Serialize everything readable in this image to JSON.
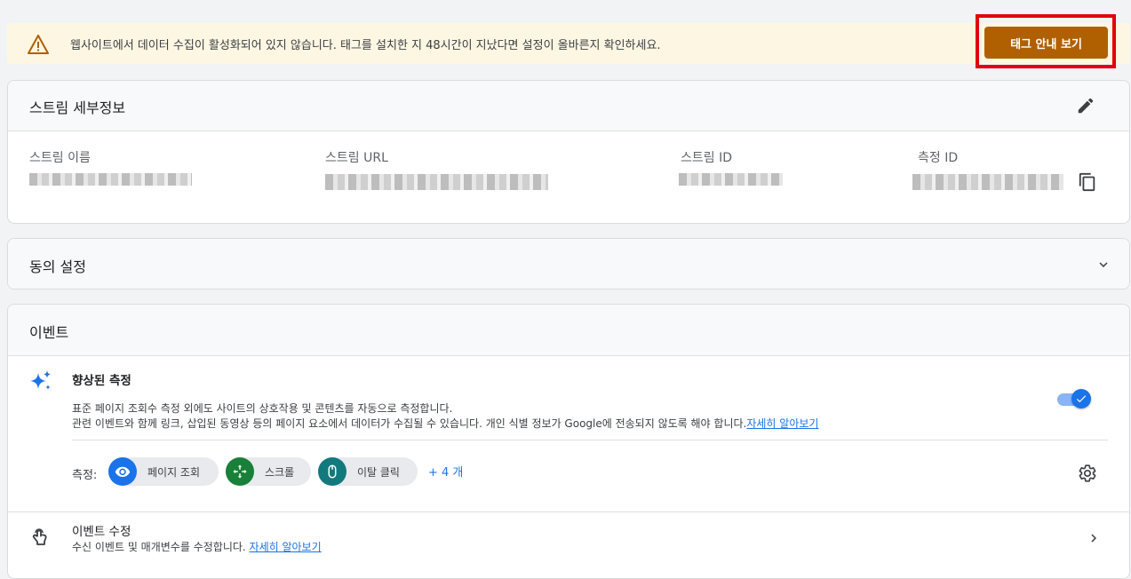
{
  "banner": {
    "message": "웹사이트에서 데이터 수집이 활성화되어 있지 않습니다. 태그를 설치한 지 48시간이 지났다면 설정이 올바른지 확인하세요.",
    "button_label": "태그 안내 보기",
    "icon": "warning-icon"
  },
  "stream_details": {
    "title": "스트림 세부정보",
    "fields": [
      {
        "label": "스트림 이름"
      },
      {
        "label": "스트림 URL"
      },
      {
        "label": "스트림 ID"
      },
      {
        "label": "측정 ID"
      }
    ]
  },
  "consent": {
    "title": "동의 설정"
  },
  "events": {
    "title": "이벤트",
    "enhanced": {
      "title": "향상된 측정",
      "desc_line1": "표준 페이지 조회수 측정 외에도 사이트의 상호작용 및 콘텐츠를 자동으로 측정합니다.",
      "desc_line2": "관련 이벤트와 함께 링크, 삽입된 동영상 등의 페이지 요소에서 데이터가 수집될 수 있습니다. 개인 식별 정보가 Google에 전송되지 않도록 해야 합니다.",
      "learn_more": "자세히 알아보기",
      "toggle_on": true,
      "measure_label": "측정:",
      "chips": [
        {
          "label": "페이지 조회",
          "icon": "eye-icon",
          "color": "#1a73e8"
        },
        {
          "label": "스크롤",
          "icon": "scroll-icon",
          "color": "#188038"
        },
        {
          "label": "이탈 클릭",
          "icon": "mouse-icon",
          "color": "#12797d"
        }
      ],
      "more": "+ 4 개"
    },
    "edit": {
      "title": "이벤트 수정",
      "desc": "수신 이벤트 및 매개변수를 수정합니다.",
      "learn_more": "자세히 알아보기"
    }
  }
}
